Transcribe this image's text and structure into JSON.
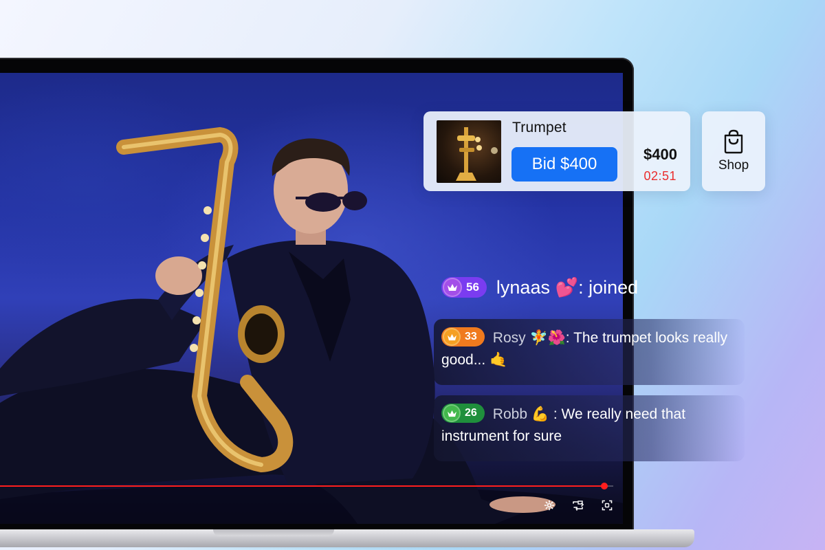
{
  "auction": {
    "product_name": "Trumpet",
    "bid_label": "Bid $400",
    "price": "$400",
    "timer": "02:51"
  },
  "shop": {
    "label": "Shop",
    "icon": "shopping-bag-icon"
  },
  "chat": {
    "joined": {
      "level": "56",
      "username": "lynaas",
      "emoji": "💕",
      "text": ": joined",
      "badge_color": "#7a3cf0"
    },
    "messages": [
      {
        "level": "33",
        "username": "Rosy",
        "emoji": "🧚🌺",
        "text": ": The trumpet looks really good... 🤙",
        "badge_color": "#f07a1e"
      },
      {
        "level": "26",
        "username": "Robb",
        "emoji": "💪",
        "text": " : We really need that instrument for sure",
        "badge_color": "#2aa84a"
      }
    ]
  },
  "player": {
    "progress": 0.985,
    "controls": [
      "settings-icon",
      "picture-in-picture-icon",
      "fullscreen-icon"
    ],
    "accent": "#ff1e1e"
  }
}
